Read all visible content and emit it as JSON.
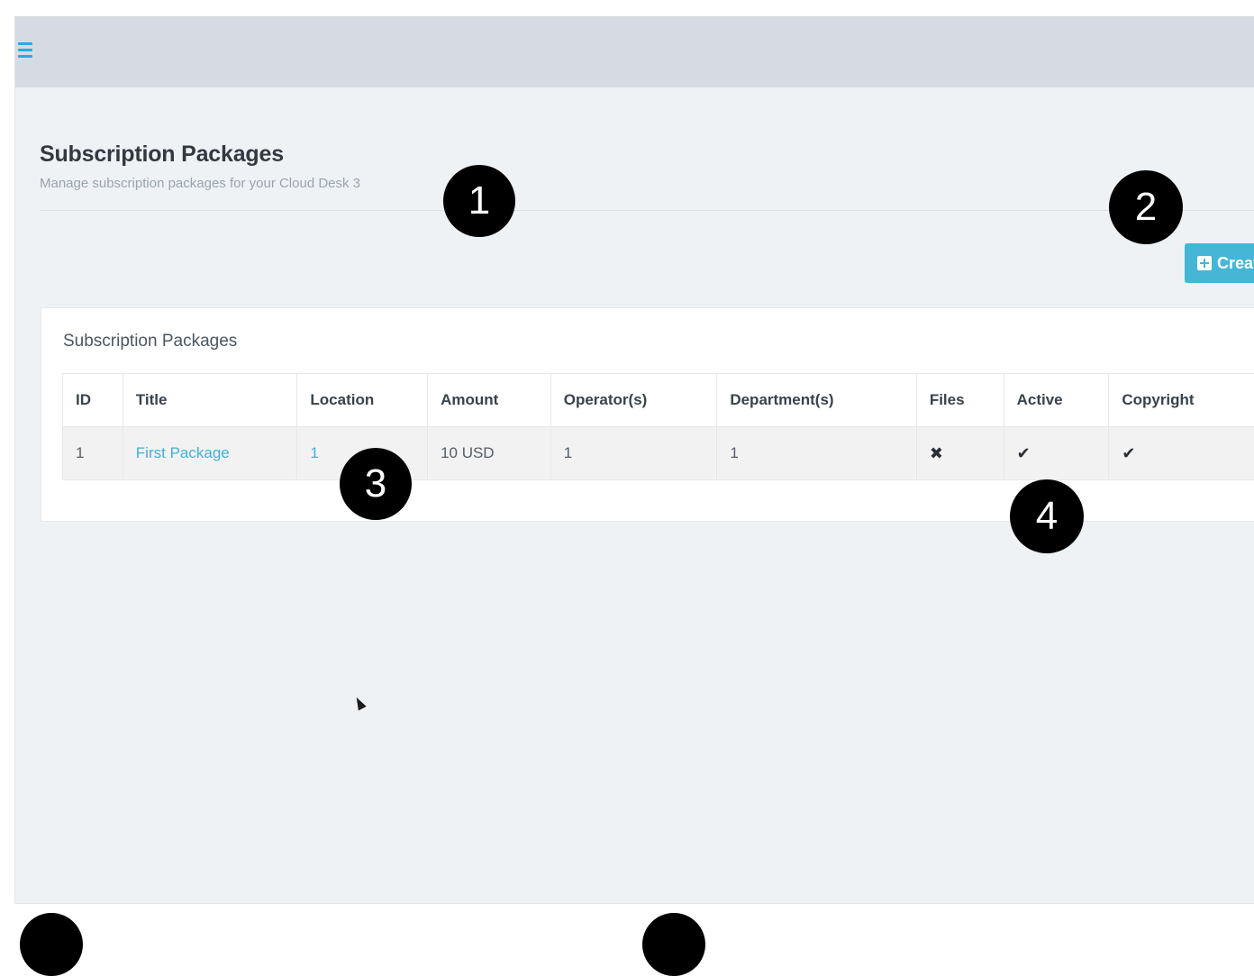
{
  "header": {
    "title": "Subscription Packages",
    "subtitle": "Manage subscription packages for your Cloud Desk 3"
  },
  "toolbar": {
    "create_label": "Create"
  },
  "panel": {
    "title": "Subscription Packages"
  },
  "table": {
    "columns": [
      "ID",
      "Title",
      "Location",
      "Amount",
      "Operator(s)",
      "Department(s)",
      "Files",
      "Active",
      "Copyright"
    ],
    "rows": [
      {
        "id": "1",
        "title": "First Package",
        "location": "1",
        "amount": "10 USD",
        "operators": "1",
        "departments": "1",
        "files": "✖",
        "active": "✔",
        "copyright": "✔"
      }
    ]
  },
  "callouts": [
    "1",
    "2",
    "3",
    "4"
  ],
  "colors": {
    "accent": "#29aadf",
    "button": "#45b6d6",
    "topbar": "#d6dbe3",
    "background": "#eff2f5"
  },
  "icons": {
    "menu": "hamburger-menu-icon",
    "create": "plus-square-icon",
    "files": "cross-icon",
    "active": "check-icon",
    "copyright": "check-icon"
  }
}
